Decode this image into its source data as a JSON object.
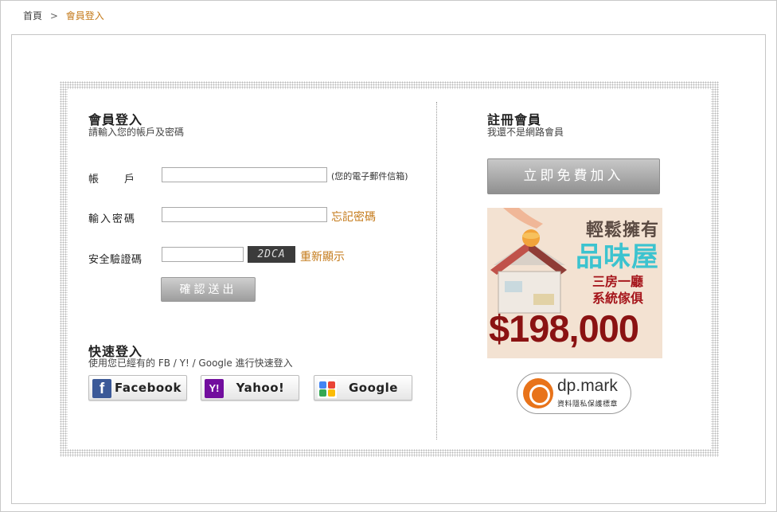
{
  "breadcrumb": {
    "home": "首頁",
    "separator": ">",
    "current": "會員登入"
  },
  "login": {
    "title": "會員登入",
    "subtitle": "請輸入您的帳戶及密碼",
    "account_label": "帳　　戶",
    "account_hint": "(您的電子郵件信箱)",
    "password_label": "輸入密碼",
    "forgot_link": "忘記密碼",
    "captcha_label": "安全驗證碼",
    "captcha_code": "2DCA",
    "refresh_link": "重新顯示",
    "submit_label": "確認送出"
  },
  "quick_login": {
    "title": "快速登入",
    "subtitle": "使用您已經有的 FB / Y! / Google 進行快速登入",
    "buttons": [
      {
        "label": "Facebook",
        "icon": "facebook-icon",
        "color": "#3b5998"
      },
      {
        "label": "Yahoo!",
        "icon": "yahoo-icon",
        "color": "#720e9e"
      },
      {
        "label": "Google",
        "icon": "google-icon",
        "color": "#4285f4"
      }
    ]
  },
  "register": {
    "title": "註冊會員",
    "subtitle": "我還不是網路會員",
    "join_label": "立即免費加入"
  },
  "ad": {
    "line1": "輕鬆擁有",
    "line2": "品味屋",
    "line3": "三房一廳",
    "line4": "系統傢俱",
    "price": "$198,000"
  },
  "dpmark": {
    "name": "dp.mark",
    "caption": "資料隱私保護標章"
  }
}
